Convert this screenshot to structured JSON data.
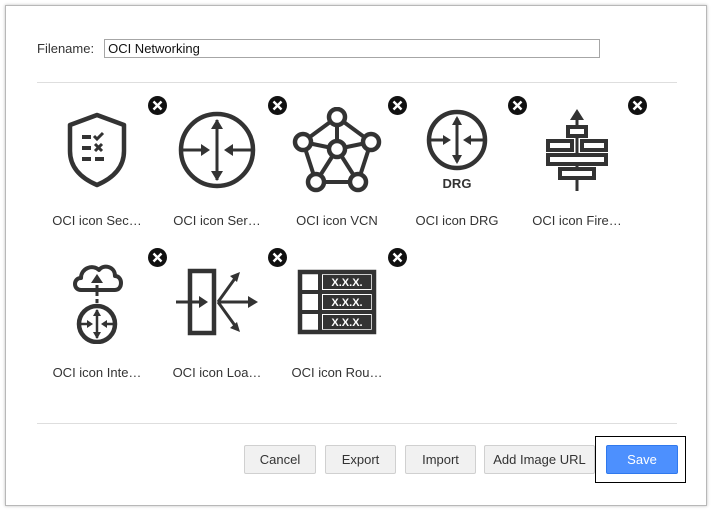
{
  "filename": {
    "label": "Filename:",
    "value": "OCI Networking"
  },
  "icons": [
    {
      "label": "OCI icon Sec…",
      "icon": "security-list-icon"
    },
    {
      "label": "OCI icon Ser…",
      "icon": "service-gateway-icon"
    },
    {
      "label": "OCI icon VCN",
      "icon": "vcn-icon"
    },
    {
      "label": "OCI icon DRG",
      "icon": "drg-icon",
      "badge": "DRG"
    },
    {
      "label": "OCI icon Fire…",
      "icon": "firewall-icon"
    },
    {
      "label": "OCI icon Inte…",
      "icon": "internet-gateway-icon"
    },
    {
      "label": "OCI icon Loa…",
      "icon": "load-balancer-icon"
    },
    {
      "label": "OCI icon Rou…",
      "icon": "route-table-icon",
      "cell_text": "X.X.X."
    }
  ],
  "buttons": {
    "cancel": "Cancel",
    "export": "Export",
    "import": "Import",
    "add_image_url": "Add Image URL",
    "save": "Save"
  },
  "colors": {
    "icon": "#333333",
    "save_button": "#4d90fe",
    "border": "#b8b8b8"
  }
}
